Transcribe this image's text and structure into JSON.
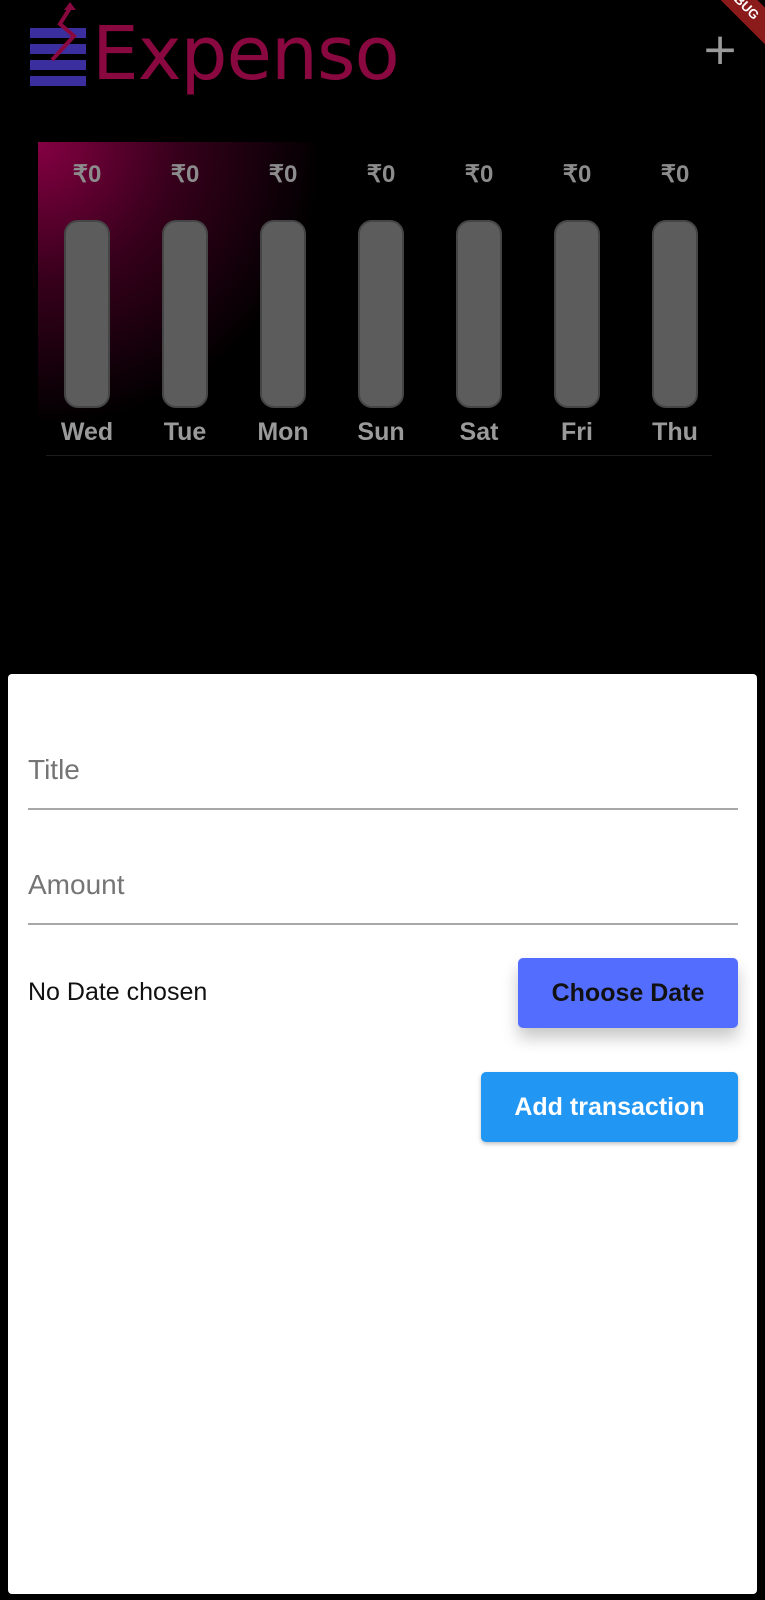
{
  "app": {
    "title": "Expenso",
    "add_icon": "plus-icon",
    "debug_label": "DEBUG",
    "brand_color": "#8a0840",
    "logo_icon_color": "#3b2e9e"
  },
  "chart_data": {
    "type": "bar",
    "categories": [
      "Wed",
      "Tue",
      "Mon",
      "Sun",
      "Sat",
      "Fri",
      "Thu"
    ],
    "amount_labels": [
      "₹0",
      "₹0",
      "₹0",
      "₹0",
      "₹0",
      "₹0",
      "₹0"
    ],
    "values": [
      0,
      0,
      0,
      0,
      0,
      0,
      0
    ],
    "spending_fraction": [
      0,
      0,
      0,
      0,
      0,
      0,
      0
    ],
    "bar_color": "#5c5c5c",
    "fill_color": "#8a0840"
  },
  "form": {
    "title_placeholder": "Title",
    "title_value": "",
    "amount_placeholder": "Amount",
    "amount_value": "",
    "date_text": "No Date chosen",
    "choose_date_label": "Choose Date",
    "add_transaction_label": "Add transaction",
    "choose_date_color": "#536dfe",
    "add_transaction_color": "#2196f3"
  }
}
